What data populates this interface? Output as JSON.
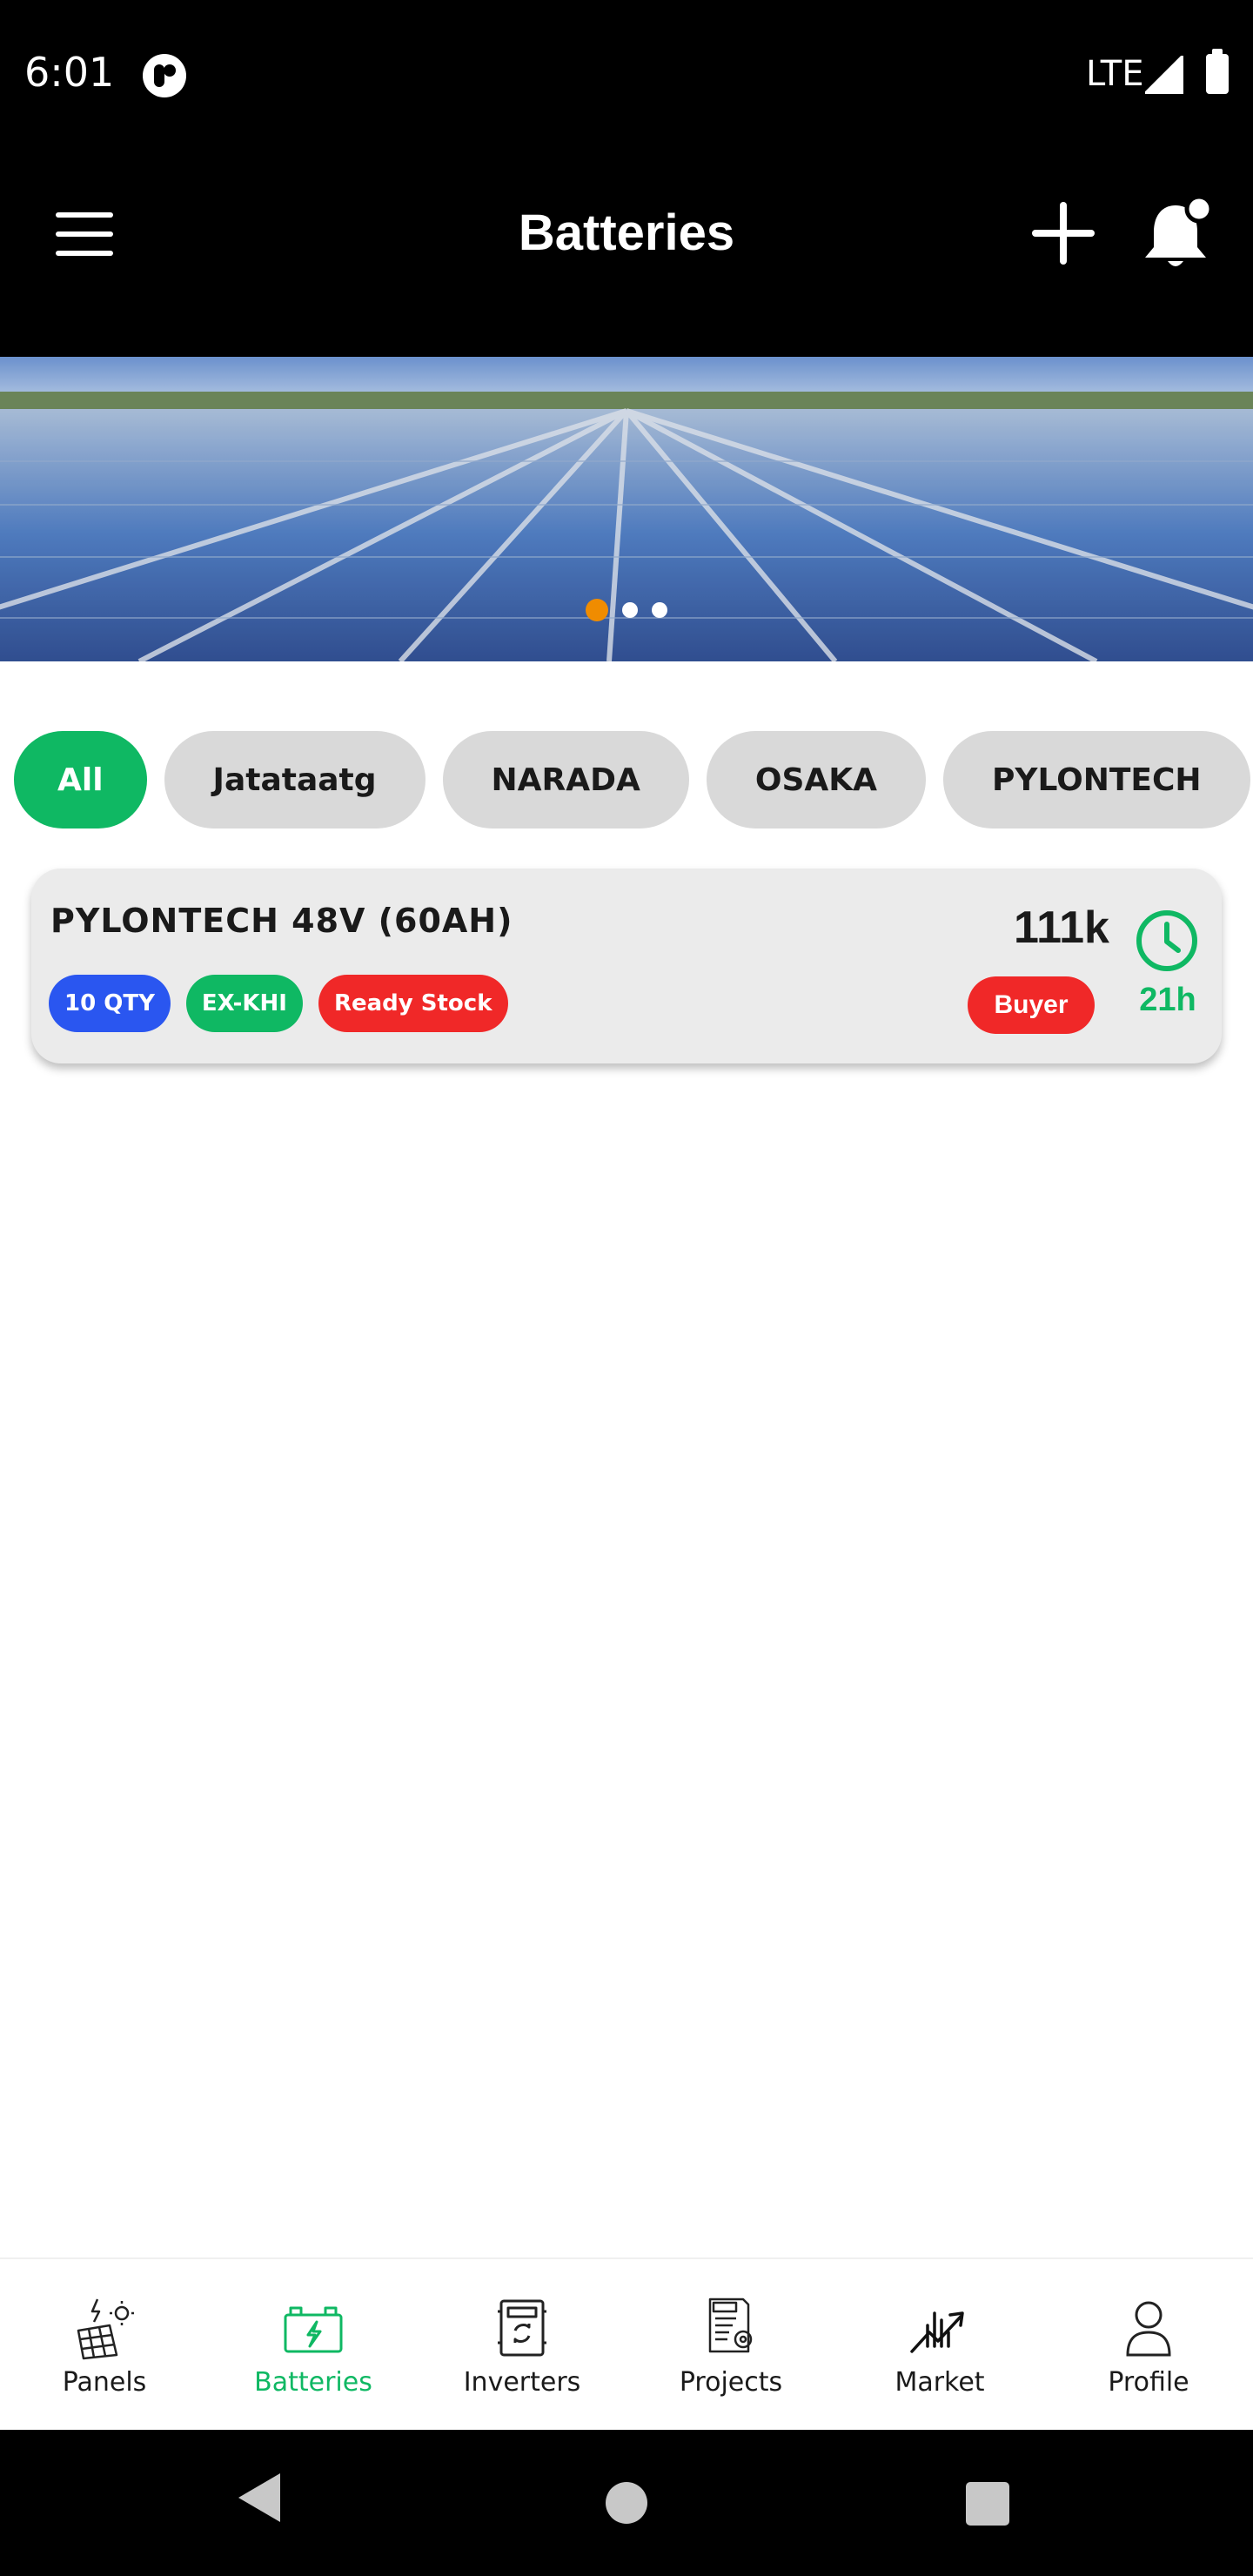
{
  "status_bar": {
    "time": "6:01",
    "network": "LTE"
  },
  "app_bar": {
    "title": "Batteries"
  },
  "banner": {
    "slide_count": 3,
    "active_slide": 1
  },
  "filters": {
    "chips": [
      "All",
      "Jatataatg",
      "NARADA",
      "OSAKA",
      "PYLONTECH"
    ],
    "selected": "All"
  },
  "listings": [
    {
      "title": "PYLONTECH 48V (60AH)",
      "badges": {
        "quantity": "10 QTY",
        "location": "EX-KHI",
        "stock": "Ready Stock"
      },
      "price": "111k",
      "role": "Buyer",
      "time_left": "21h"
    }
  ],
  "bottom_nav": {
    "items": [
      {
        "label": "Panels",
        "icon": "solar-panel-icon"
      },
      {
        "label": "Batteries",
        "icon": "battery-icon"
      },
      {
        "label": "Inverters",
        "icon": "inverter-icon"
      },
      {
        "label": "Projects",
        "icon": "project-document-icon"
      },
      {
        "label": "Market",
        "icon": "market-chart-icon"
      },
      {
        "label": "Profile",
        "icon": "profile-icon"
      }
    ],
    "active": "Batteries"
  },
  "colors": {
    "accent_green": "#0fb863",
    "badge_blue": "#2a56f0",
    "badge_red": "#f02828",
    "carousel_active_dot": "#f08c00"
  }
}
